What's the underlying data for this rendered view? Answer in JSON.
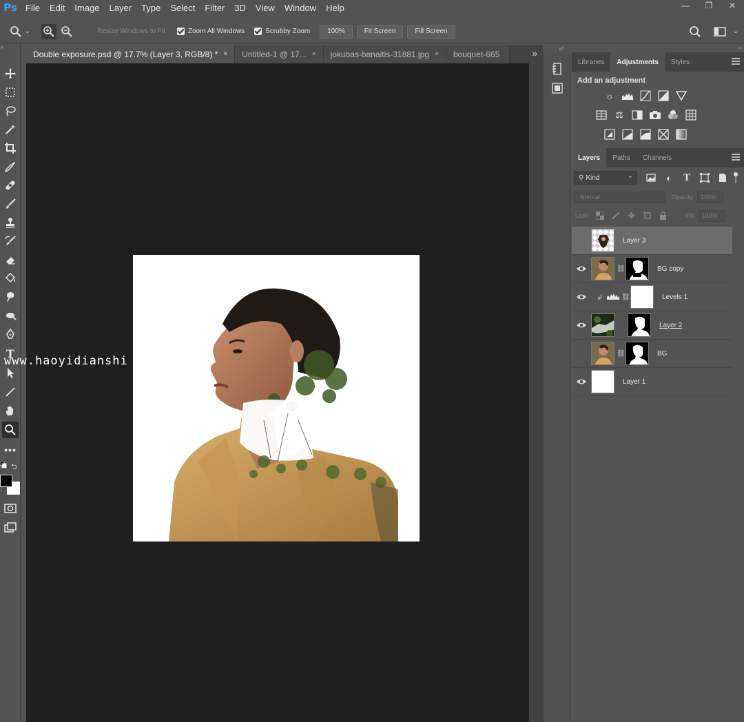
{
  "app": {
    "logo": "Ps"
  },
  "menu": [
    "File",
    "Edit",
    "Image",
    "Layer",
    "Type",
    "Select",
    "Filter",
    "3D",
    "View",
    "Window",
    "Help"
  ],
  "window_controls": {
    "minimize": "—",
    "restore": "❐",
    "close": "✕"
  },
  "options": {
    "resize_windows": "Resize Windows to Fit",
    "zoom_all": "Zoom All Windows",
    "scrubby_zoom": "Scrubby Zoom",
    "percent_btn": "100%",
    "fit_screen": "Fit Screen",
    "fill_screen": "Fill Screen"
  },
  "tabs": [
    {
      "label": "Double exposure.psd @ 17.7% (Layer 3, RGB/8) *",
      "close": "×"
    },
    {
      "label": "Untitled-1 @ 17...",
      "close": "×"
    },
    {
      "label": "jokubas-banaitis-31881.jpg",
      "close": "×"
    },
    {
      "label": "bouquet-665",
      "close": ""
    }
  ],
  "tab_overflow": "»",
  "watermark": "www.haoyidianshi",
  "adjustments_panel": {
    "tabs": [
      "Libraries",
      "Adjustments",
      "Styles"
    ],
    "title": "Add an adjustment"
  },
  "layers_panel": {
    "tabs": [
      "Layers",
      "Paths",
      "Channels"
    ],
    "kind_label": "Kind",
    "blend_mode": "Normal",
    "opacity_label": "Opacity:",
    "opacity_value": "100%",
    "lock_label": "Lock:",
    "fill_label": "Fill:",
    "fill_value": "100%",
    "layers": [
      {
        "name": "Layer 3",
        "visible": false,
        "selected": true
      },
      {
        "name": "BG copy",
        "visible": true,
        "selected": false
      },
      {
        "name": "Levels 1",
        "visible": true,
        "selected": false
      },
      {
        "name": "Layer 2",
        "visible": true,
        "selected": false
      },
      {
        "name": "BG",
        "visible": false,
        "selected": false
      },
      {
        "name": "Layer 1",
        "visible": true,
        "selected": false
      }
    ]
  },
  "colors": {
    "canvas_bg": "#1e1f1f",
    "ui_bg": "#535353",
    "selected_layer": "#6c6c6c",
    "ps_blue": "#31a8ff"
  }
}
